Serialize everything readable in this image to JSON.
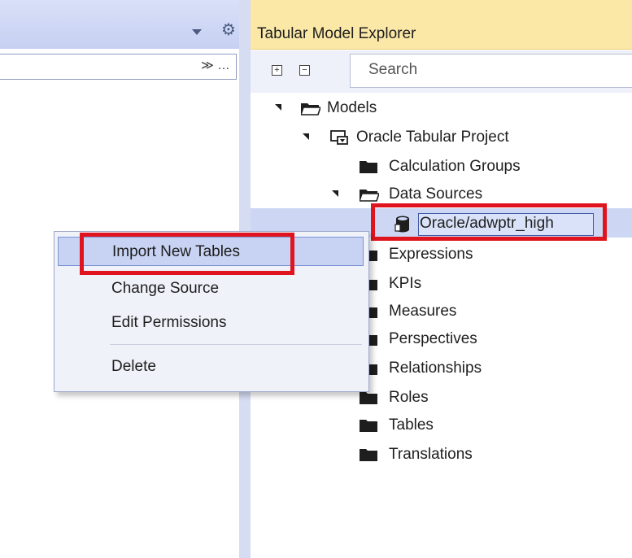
{
  "left_panel": {
    "toolbar_buttons": [
      "≫",
      "…"
    ]
  },
  "explorer": {
    "title": "Tabular Model Explorer",
    "search": {
      "placeholder": "Search",
      "value": ""
    },
    "tree": {
      "models": "Models",
      "project": "Oracle Tabular Project",
      "calculation_groups": "Calculation Groups",
      "data_sources": "Data Sources",
      "selected_source": "Oracle/adwptr_high",
      "expressions": "Expressions",
      "kpis": "KPIs",
      "measures": "Measures",
      "perspectives": "Perspectives",
      "relationships": "Relationships",
      "roles": "Roles",
      "tables": "Tables",
      "translations": "Translations"
    }
  },
  "context_menu": {
    "items": [
      "Import New Tables",
      "Change Source",
      "Edit Permissions",
      "Delete"
    ]
  },
  "colors": {
    "highlight_red": "#e0141e",
    "explorer_title_bg": "#fbe8a7",
    "selection_bg": "#cdd7f4"
  }
}
